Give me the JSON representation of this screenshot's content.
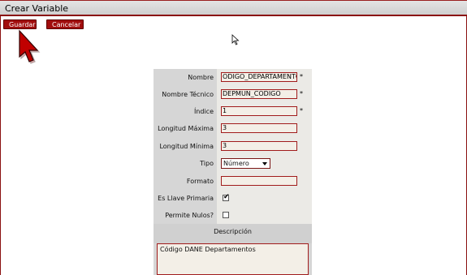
{
  "window": {
    "title": "Crear Variable"
  },
  "toolbar": {
    "save_label": "Guardar",
    "cancel_label": "Cancelar"
  },
  "form": {
    "nombre": {
      "label": "Nombre",
      "value": "ODIGO_DEPARTAMENTO",
      "required_mark": "*"
    },
    "nombre_tecnico": {
      "label": "Nombre Técnico",
      "value": "DEPMUN_CODIGO",
      "required_mark": "*"
    },
    "indice": {
      "label": "Índice",
      "value": "1",
      "required_mark": "*"
    },
    "longitud_maxima": {
      "label": "Longitud Máxima",
      "value": "3"
    },
    "longitud_minima": {
      "label": "Longitud Mínima",
      "value": "3"
    },
    "tipo": {
      "label": "Tipo",
      "value": "Número"
    },
    "formato": {
      "label": "Formato",
      "value": ""
    },
    "llave_primaria": {
      "label": "Es Llave Primaria",
      "checked": true,
      "mark": "✔"
    },
    "permite_nulos": {
      "label": "Permite Nulos?",
      "checked": false
    },
    "descripcion": {
      "label": "Descripción",
      "value": "Código DANE Departamentos"
    }
  },
  "colors": {
    "accent": "#a10d0d",
    "panel": "#d6d6d6",
    "field_bg": "#f3efe7"
  }
}
